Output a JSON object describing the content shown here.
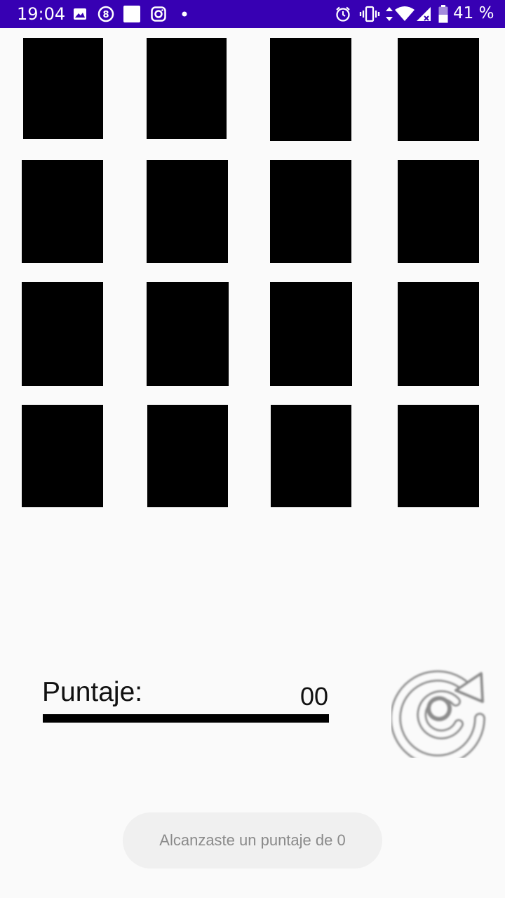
{
  "status_bar": {
    "time": "19:04",
    "battery_percent": "41 %",
    "background_color": "#3700b3",
    "left_icons": [
      "image-icon",
      "counter-8-icon",
      "blank-square-icon",
      "instagram-icon",
      "dot-icon"
    ],
    "right_icons": [
      "alarm-icon",
      "vibrate-icon",
      "data-arrows-icon",
      "wifi-icon",
      "signal-icon",
      "battery-icon"
    ]
  },
  "board": {
    "rows": 4,
    "columns": 4,
    "card_color": "#000000",
    "cards_face_down": 16
  },
  "score": {
    "label": "Puntaje:",
    "value": "00"
  },
  "reset_button": {
    "icon": "reset-rotate-icon"
  },
  "toast": {
    "message": "Alcanzaste un puntaje de 0"
  }
}
